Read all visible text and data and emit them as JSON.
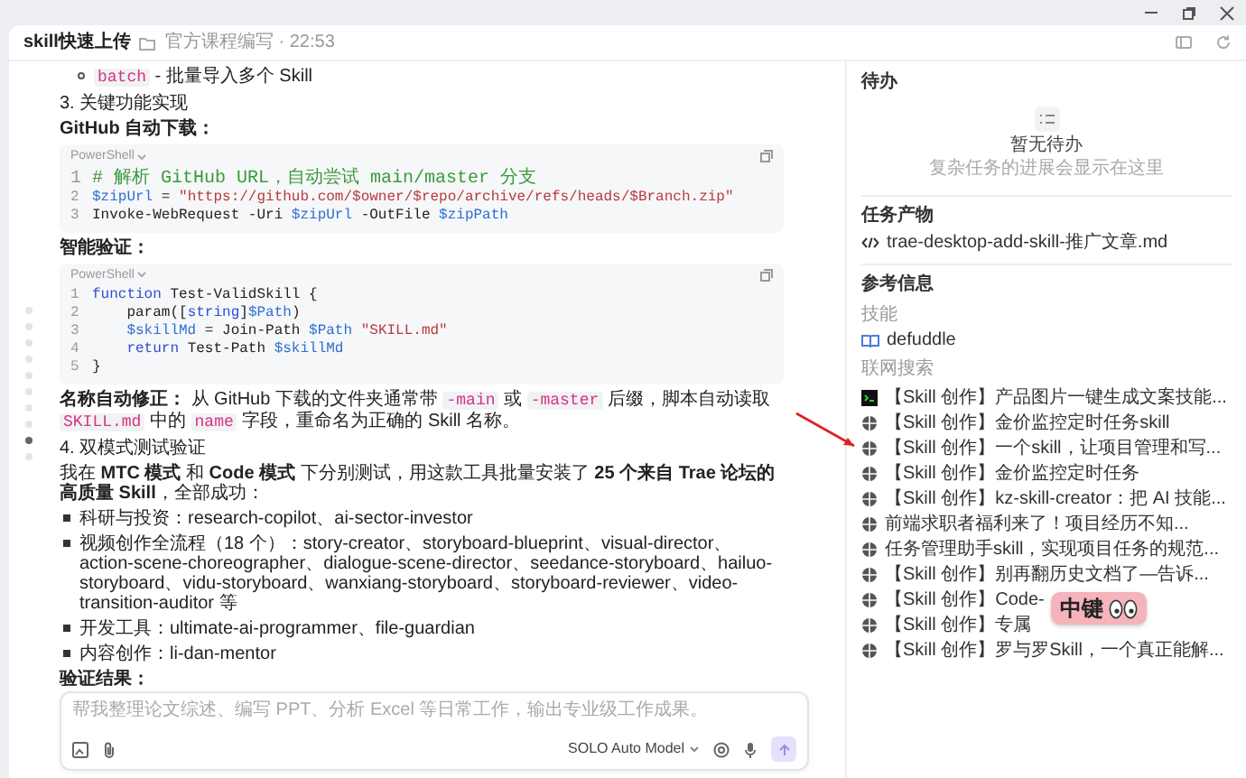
{
  "header": {
    "title": "skill快速上传",
    "folder": "官方课程编写 · 22:53"
  },
  "nav_dots": [
    {
      "selected": false
    },
    {
      "selected": false
    },
    {
      "selected": false
    },
    {
      "selected": false
    },
    {
      "selected": false
    },
    {
      "selected": false
    },
    {
      "selected": false
    },
    {
      "selected": false
    },
    {
      "selected": true
    },
    {
      "selected": false
    }
  ],
  "content": [
    {
      "kind": "circle-bullet",
      "segments": [
        {
          "kind": "code",
          "text": "batch"
        },
        {
          "kind": "plain",
          "text": " - 批量导入多个 Skill"
        }
      ]
    },
    {
      "kind": "para",
      "segments": [
        {
          "kind": "plain",
          "text": "3. 关键功能实现"
        }
      ]
    },
    {
      "kind": "para",
      "segments": [
        {
          "kind": "bold",
          "text": "GitHub 自动下载："
        }
      ]
    },
    {
      "kind": "codeblock",
      "language": "PowerShell",
      "lines": [
        {
          "n": "1",
          "tokens": [
            {
              "kind": "comment",
              "text": "# 解析 GitHub URL，自动尝试 main/master 分支"
            }
          ]
        },
        {
          "n": "2",
          "tokens": [
            {
              "kind": "var",
              "text": "$zipUrl"
            },
            {
              "kind": "plain",
              "text": " = "
            },
            {
              "kind": "string",
              "text": "\"https://github.com/$owner/$repo/archive/refs/heads/$Branch.zip\""
            }
          ]
        },
        {
          "n": "3",
          "tokens": [
            {
              "kind": "plain",
              "text": "Invoke-WebRequest -Uri "
            },
            {
              "kind": "var",
              "text": "$zipUrl"
            },
            {
              "kind": "plain",
              "text": " -OutFile "
            },
            {
              "kind": "var",
              "text": "$zipPath"
            }
          ]
        }
      ]
    },
    {
      "kind": "para",
      "segments": [
        {
          "kind": "bold",
          "text": "智能验证："
        }
      ]
    },
    {
      "kind": "codeblock",
      "language": "PowerShell",
      "lines": [
        {
          "n": "1",
          "tokens": [
            {
              "kind": "keyword",
              "text": "function"
            },
            {
              "kind": "plain",
              "text": " Test-ValidSkill {"
            }
          ]
        },
        {
          "n": "2",
          "indent": true,
          "tokens": [
            {
              "kind": "plain",
              "text": "param(["
            },
            {
              "kind": "keyword",
              "text": "string"
            },
            {
              "kind": "plain",
              "text": "]"
            },
            {
              "kind": "var",
              "text": "$Path"
            },
            {
              "kind": "plain",
              "text": ")"
            }
          ]
        },
        {
          "n": "3",
          "indent": true,
          "tokens": [
            {
              "kind": "var",
              "text": "$skillMd"
            },
            {
              "kind": "plain",
              "text": " = Join-Path "
            },
            {
              "kind": "var",
              "text": "$Path"
            },
            {
              "kind": "string",
              "text": " \"SKILL.md\""
            }
          ]
        },
        {
          "n": "4",
          "indent": true,
          "tokens": [
            {
              "kind": "keyword",
              "text": "return"
            },
            {
              "kind": "plain",
              "text": " Test-Path "
            },
            {
              "kind": "var",
              "text": "$skillMd"
            }
          ]
        },
        {
          "n": "5",
          "tokens": [
            {
              "kind": "plain",
              "text": "}"
            }
          ]
        }
      ]
    },
    {
      "kind": "para",
      "segments": [
        {
          "kind": "bold",
          "text": "名称自动修正："
        },
        {
          "kind": "plain",
          "text": " 从 GitHub 下载的文件夹通常带 "
        },
        {
          "kind": "code",
          "text": "-main"
        },
        {
          "kind": "plain",
          "text": " 或 "
        },
        {
          "kind": "code",
          "text": "-master"
        },
        {
          "kind": "plain",
          "text": " 后缀，脚本自动读取 "
        },
        {
          "kind": "code",
          "text": "SKILL.md"
        },
        {
          "kind": "plain",
          "text": " 中的 "
        },
        {
          "kind": "code",
          "text": "name"
        },
        {
          "kind": "plain",
          "text": " 字段，重命名为正确的 Skill 名称。"
        }
      ]
    },
    {
      "kind": "para",
      "segments": [
        {
          "kind": "plain",
          "text": "4. 双模式测试验证"
        }
      ]
    },
    {
      "kind": "para",
      "segments": [
        {
          "kind": "plain",
          "text": "我在 "
        },
        {
          "kind": "bold",
          "text": "MTC 模式"
        },
        {
          "kind": "plain",
          "text": " 和 "
        },
        {
          "kind": "bold",
          "text": "Code 模式"
        },
        {
          "kind": "plain",
          "text": " 下分别测试，用这款工具批量安装了 "
        },
        {
          "kind": "bold",
          "text": "25 个来自 Trae 论坛的高质量 Skill"
        },
        {
          "kind": "plain",
          "text": "，全部成功："
        }
      ]
    },
    {
      "kind": "square-bullet",
      "segments": [
        {
          "kind": "plain",
          "text": "科研与投资：research-copilot、ai-sector-investor"
        }
      ]
    },
    {
      "kind": "square-bullet",
      "segments": [
        {
          "kind": "plain",
          "text": "视频创作全流程（18 个）：story-creator、storyboard-blueprint、visual-director、action-scene-choreographer、dialogue-scene-director、seedance-storyboard、hailuo-storyboard、vidu-storyboard、wanxiang-storyboard、storyboard-reviewer、video-transition-auditor 等"
        }
      ]
    },
    {
      "kind": "square-bullet",
      "segments": [
        {
          "kind": "plain",
          "text": "开发工具：ultimate-ai-programmer、file-guardian"
        }
      ]
    },
    {
      "kind": "square-bullet",
      "segments": [
        {
          "kind": "plain",
          "text": "内容创作：li-dan-mentor"
        }
      ]
    },
    {
      "kind": "para",
      "segments": [
        {
          "kind": "bold",
          "text": "验证结果："
        }
      ]
    }
  ],
  "composer": {
    "placeholder": "帮我整理论文综述、编写 PPT、分析 Excel 等日常工作，输出专业级工作成果。",
    "model": "SOLO Auto Model"
  },
  "sidebar": {
    "todo": {
      "title": "待办",
      "empty_title": "暂无待办",
      "empty_hint": "复杂任务的进展会显示在这里"
    },
    "artifacts": {
      "title": "任务产物",
      "files": [
        "trae-desktop-add-skill-推广文章.md"
      ]
    },
    "references": {
      "title": "参考信息",
      "skills_title": "技能",
      "skills": [
        "defuddle"
      ],
      "search_title": "联网搜索",
      "results": [
        {
          "kind": "terminal",
          "text": "【Skill 创作】产品图片一键生成文案技能..."
        },
        {
          "kind": "globe",
          "text": "【Skill 创作】金价监控定时任务skill"
        },
        {
          "kind": "globe",
          "text": "【Skill 创作】一个skill，让项目管理和写..."
        },
        {
          "kind": "globe",
          "text": "【Skill 创作】金价监控定时任务"
        },
        {
          "kind": "globe",
          "text": "【Skill 创作】kz-skill-creator：把 AI 技能..."
        },
        {
          "kind": "globe",
          "text": "前端求职者福利来了！项目经历不知..."
        },
        {
          "kind": "globe",
          "text": "任务管理助手skill，实现项目任务的规范..."
        },
        {
          "kind": "globe",
          "text": "【Skill 创作】别再翻历史文档了—告诉..."
        },
        {
          "kind": "globe",
          "text": "【Skill 创作】Code-",
          "overlay": {
            "label": "中键"
          }
        },
        {
          "kind": "globe",
          "text": "【Skill 创作】专属"
        },
        {
          "kind": "globe",
          "text": "【Skill 创作】罗与罗Skill，一个真正能解..."
        }
      ]
    }
  }
}
